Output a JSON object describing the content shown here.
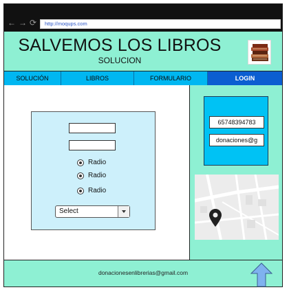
{
  "browser": {
    "url": "http://moqups.com",
    "back_icon": "arrow-left-icon",
    "forward_icon": "arrow-right-icon",
    "reload_icon": "reload-icon"
  },
  "header": {
    "title": "SALVEMOS LOS LIBROS",
    "subtitle": "SOLUCION",
    "logo_icon": "books-stack-icon"
  },
  "nav": {
    "tabs": [
      {
        "label": "SOLUCIÓN",
        "active": false
      },
      {
        "label": "LIBROS",
        "active": false
      },
      {
        "label": "FORMULARIO",
        "active": false
      },
      {
        "label": "LOGIN",
        "active": true
      }
    ]
  },
  "form": {
    "inputs": [
      {
        "value": ""
      },
      {
        "value": ""
      }
    ],
    "radios": [
      {
        "label": "Radio",
        "checked": true
      },
      {
        "label": "Radio",
        "checked": true
      },
      {
        "label": "Radio",
        "checked": true
      }
    ],
    "select": {
      "value": "Select"
    }
  },
  "sidebar": {
    "phone": "65748394783",
    "email": "donaciones@g",
    "map_pin_icon": "map-pin-icon"
  },
  "footer": {
    "email": "donacionesenlibrerias@gmail.com",
    "scroll_top_icon": "arrow-up-icon"
  },
  "colors": {
    "mint": "#8ef0d3",
    "cyan": "#00b7f1",
    "active_tab": "#0b5ed1",
    "form_bg": "#cdf0fb"
  }
}
